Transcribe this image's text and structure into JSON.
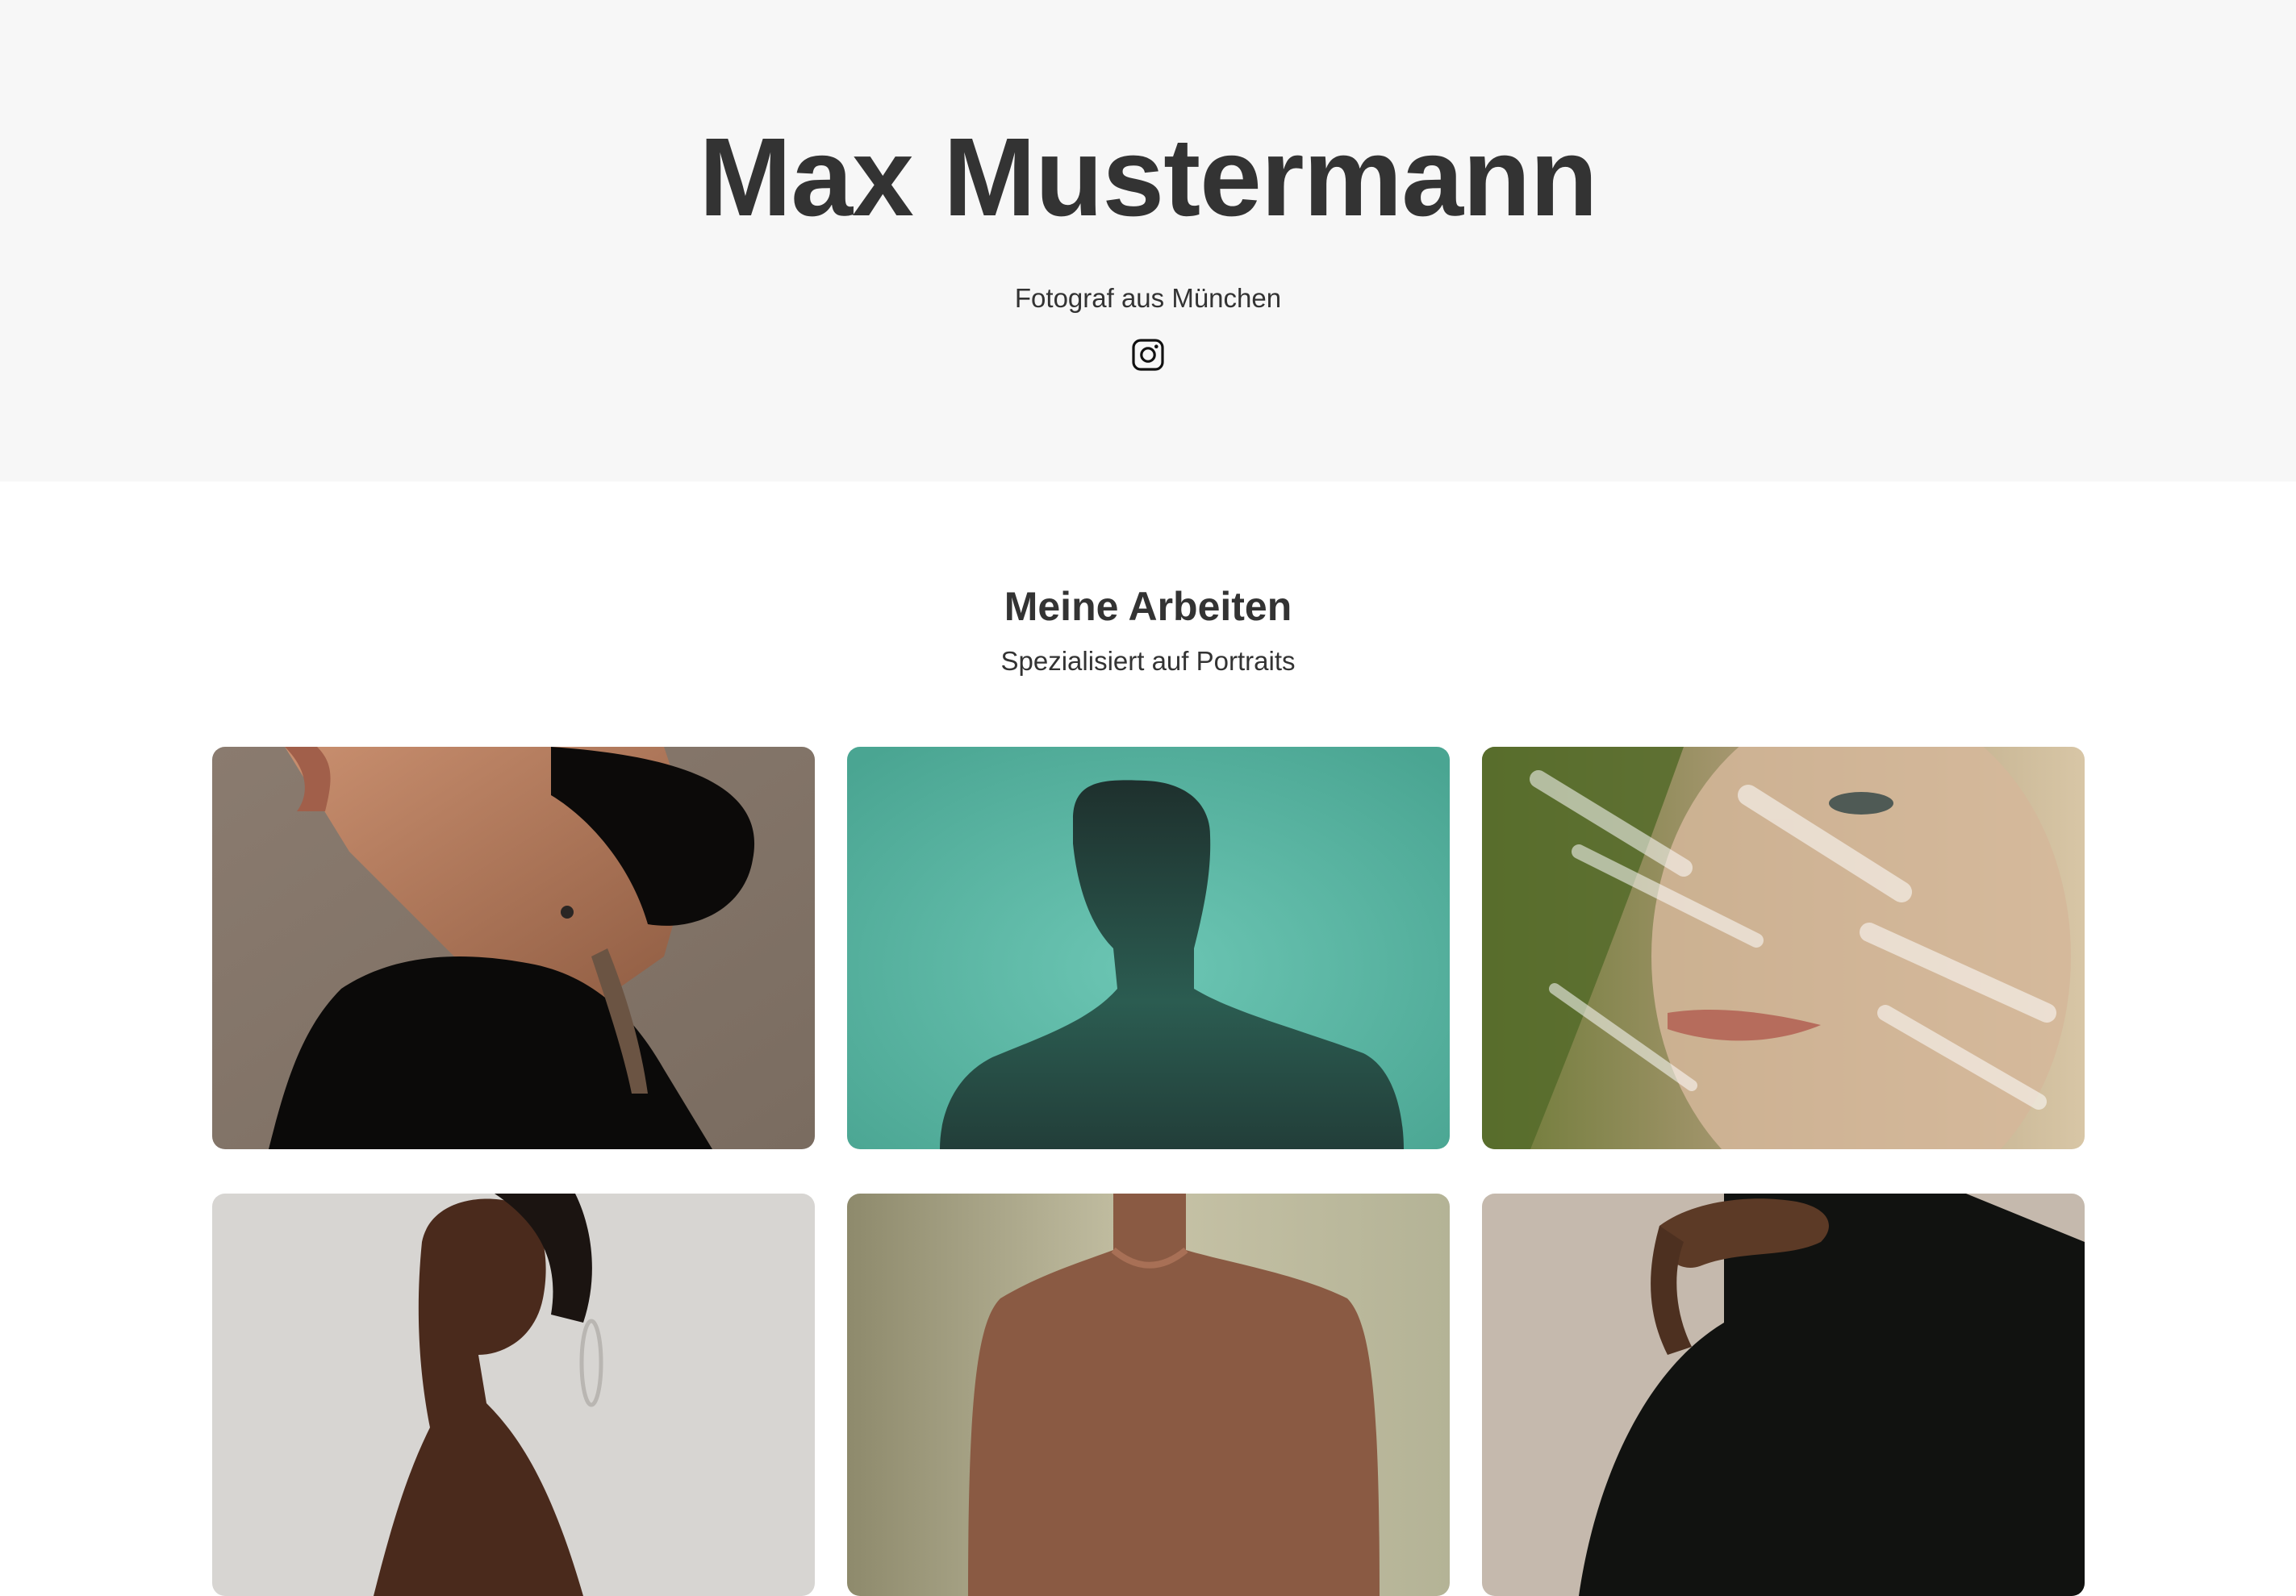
{
  "hero": {
    "title": "Max Mustermann",
    "subtitle": "Fotograf aus München",
    "social_icon": "instagram-icon"
  },
  "works": {
    "title": "Meine Arbeiten",
    "subtitle": "Spezialisiert auf Portraits"
  },
  "gallery": {
    "items": [
      {
        "photo": "portrait-woman-black-hat",
        "background": "#85776b"
      },
      {
        "photo": "silhouette-man-teal",
        "background": "#5cb5a3"
      },
      {
        "photo": "portrait-woman-leaves",
        "background": "#8d8c56"
      },
      {
        "photo": "portrait-woman-hoop-earring",
        "background": "#d6d4d1"
      },
      {
        "photo": "portrait-man-tshirt",
        "background": "#b9b79a"
      },
      {
        "photo": "portrait-woman-black-jacket",
        "background": "#c2b6aa"
      }
    ]
  },
  "colors": {
    "hero_bg": "#f7f7f7",
    "text": "#333333",
    "page_bg": "#ffffff"
  }
}
